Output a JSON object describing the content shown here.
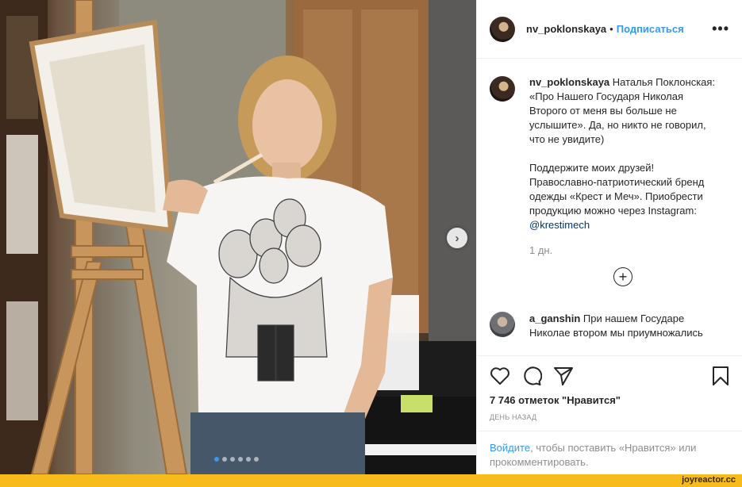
{
  "post": {
    "username": "nv_poklonskaya",
    "separator": "•",
    "follow_label": "Подписаться",
    "more_label": "•••",
    "photo_alt_icon": "carousel-next-icon",
    "carousel_next_glyph": "›",
    "carousel": {
      "count": 6,
      "active": 0
    }
  },
  "caption": {
    "username": "nv_poklonskaya",
    "text_1": "Наталья Поклонская: «Про Нашего Государя Николая Второго от меня вы больше не услышите». Да, но никто не говорил, что не увидите)",
    "text_2": "Поддержите моих друзей!Православно-патриотический бренд одежды «Крест и Меч». Приобрести продукцию можно через Instagram:",
    "mention": "@krestimech",
    "age": "1 дн."
  },
  "load_more_glyph": "+",
  "comment": {
    "username": "a_ganshin",
    "text": "При нашем Государе Николае втором мы приумножались"
  },
  "actions": {
    "like_icon": "heart-icon",
    "comment_icon": "comment-icon",
    "share_icon": "share-icon",
    "save_icon": "bookmark-icon"
  },
  "likes_text": "7 746 отметок \"Нравится\"",
  "date_text": "ДЕНЬ НАЗАД",
  "login": {
    "link": "Войдите",
    "text": ", чтобы поставить «Нравится» или прокомментировать."
  },
  "footer": {
    "brand": "joyreactor.cc"
  },
  "colors": {
    "accent": "#3897f0",
    "footer": "#f8bb1c"
  }
}
